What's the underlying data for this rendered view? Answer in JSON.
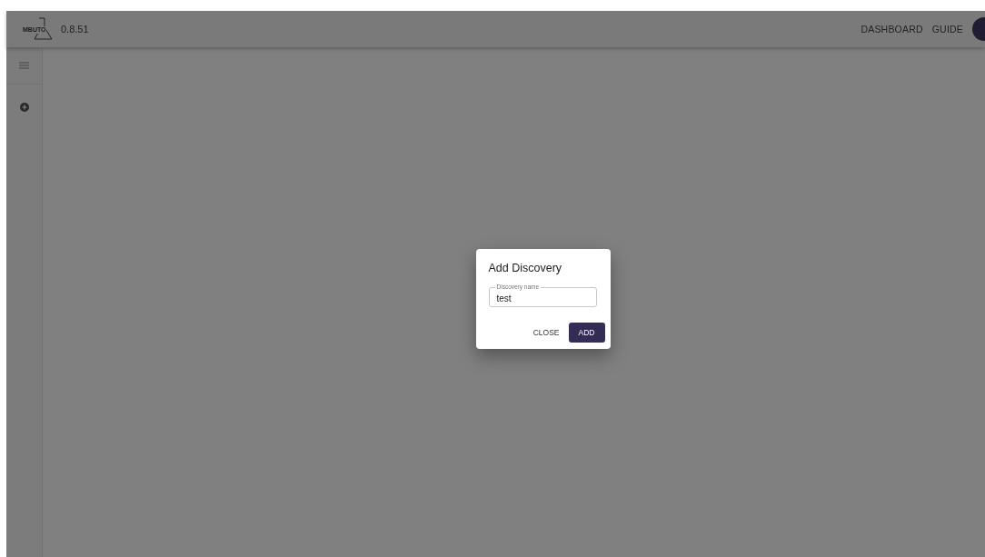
{
  "header": {
    "logo_text": "MBUTO",
    "version": "0.8.51",
    "nav": [
      "DASHBOARD",
      "GUIDE"
    ]
  },
  "dialog": {
    "title": "Add Discovery",
    "field": {
      "label": "Discovery name",
      "value": "test"
    },
    "buttons": [
      {
        "label": "CLOSE",
        "kind": "text"
      },
      {
        "label": "ADD",
        "kind": "primary"
      }
    ]
  }
}
